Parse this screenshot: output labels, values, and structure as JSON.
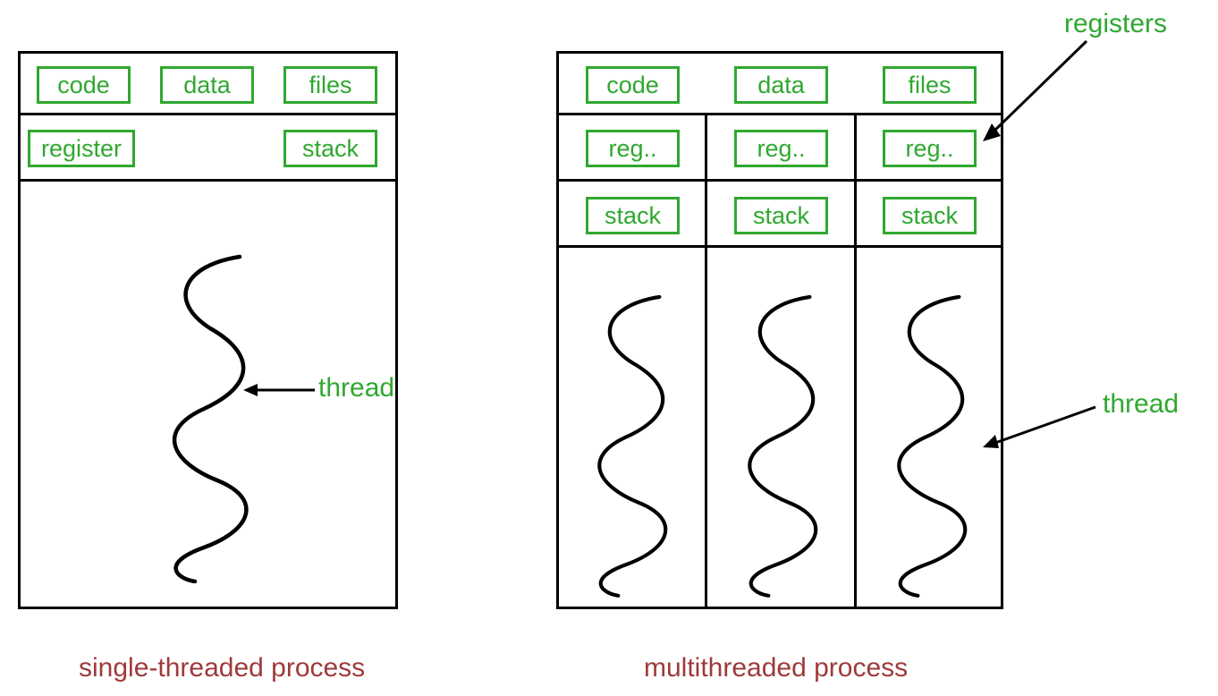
{
  "single": {
    "header": {
      "code": "code",
      "data": "data",
      "files": "files"
    },
    "row2": {
      "register": "register",
      "stack": "stack"
    },
    "thread_label": "thread",
    "caption": "single-threaded process"
  },
  "multi": {
    "header": {
      "code": "code",
      "data": "data",
      "files": "files"
    },
    "registers_label": "registers",
    "thread_label": "thread",
    "columns": [
      {
        "reg": "reg..",
        "stack": "stack"
      },
      {
        "reg": "reg..",
        "stack": "stack"
      },
      {
        "reg": "reg..",
        "stack": "stack"
      }
    ],
    "caption": "multithreaded process"
  }
}
